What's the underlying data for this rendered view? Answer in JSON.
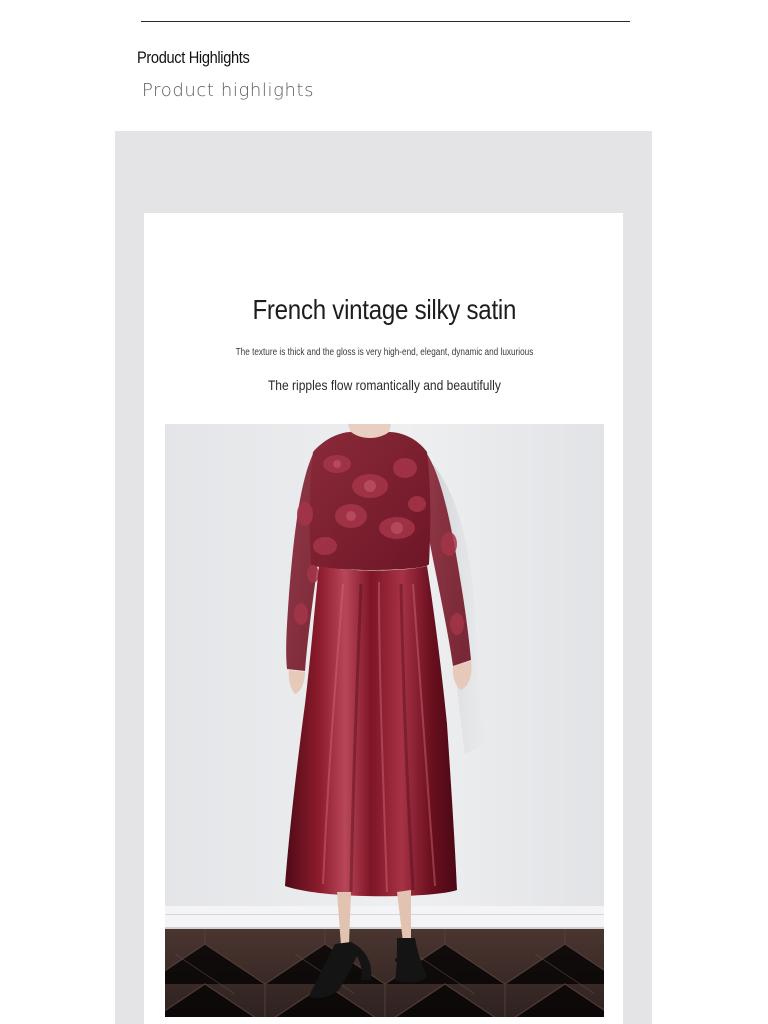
{
  "section": {
    "title": "Product Highlights",
    "subtitle": "Product highlights"
  },
  "card": {
    "title": "French vintage silky satin",
    "tagline_small": "The texture is thick and the gloss is very high-end, elegant, dynamic and luxurious",
    "tagline": "The ripples flow romantically and beautifully"
  },
  "colors": {
    "panel_bg": "#e4e4e6",
    "card_bg": "#ffffff",
    "garment_burgundy": "#7a1424",
    "floor_wood": "#3a2a26"
  }
}
